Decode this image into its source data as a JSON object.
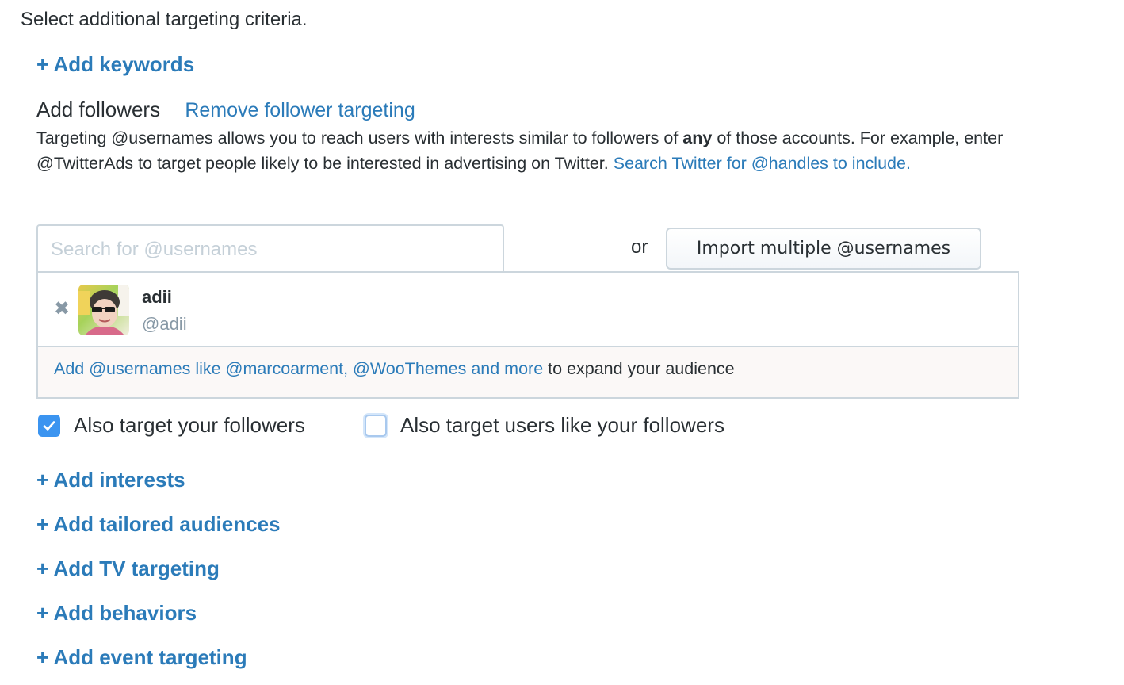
{
  "page": {
    "title": "Select additional targeting criteria.",
    "add_keywords": "+ Add keywords"
  },
  "followers": {
    "heading": "Add followers",
    "remove_link": "Remove follower targeting",
    "description_part1": "Targeting @usernames allows you to reach users with interests similar to followers of ",
    "description_bold": "any",
    "description_part2": " of those accounts. For example, enter @TwitterAds to target people likely to be interested in advertising on Twitter. ",
    "description_link": "Search Twitter for @handles to include.",
    "search_placeholder": "Search for @usernames",
    "search_value": "",
    "or_label": "or",
    "import_button": "Import multiple @usernames",
    "selected_users": [
      {
        "name": "adii",
        "handle": "@adii",
        "remove_icon": "close-icon"
      }
    ],
    "suggestion_link": "Add @usernames like @marcoarment, @WooThemes and more",
    "suggestion_text": " to expand your audience"
  },
  "options": [
    {
      "label": "Also target your followers",
      "checked": true
    },
    {
      "label": "Also target users like your followers",
      "checked": false
    }
  ],
  "more_links": [
    "+ Add interests",
    "+ Add tailored audiences",
    "+ Add TV targeting",
    "+ Add behaviors",
    "+ Add event targeting"
  ],
  "colors": {
    "link": "#2b7bb9",
    "text": "#292f33",
    "checkbox_checked": "#3b94f0",
    "border": "#ccd6dd"
  }
}
